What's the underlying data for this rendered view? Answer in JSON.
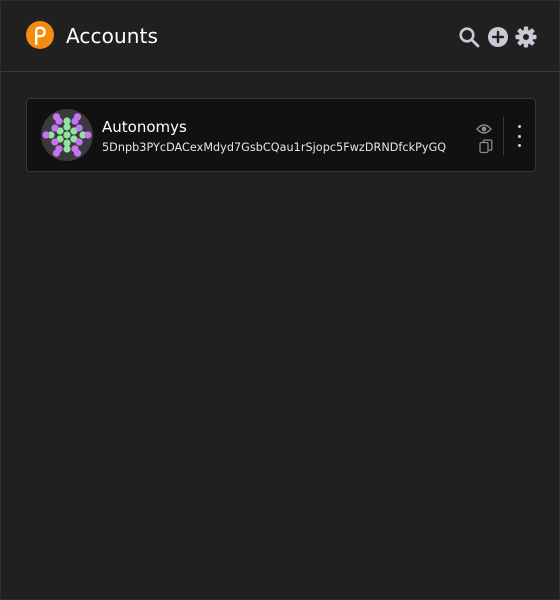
{
  "header": {
    "title": "Accounts",
    "logo_icon": "polkadot-logo-icon",
    "actions": [
      {
        "name": "search",
        "icon": "search-icon"
      },
      {
        "name": "add-account",
        "icon": "plus-circle-icon"
      },
      {
        "name": "settings",
        "icon": "gear-icon"
      }
    ]
  },
  "accounts": [
    {
      "name": "Autonomys",
      "address": "5Dnpb3PYcDACexMdyd7GsbCQau1rSjopc5FwzDRNDfckPyGQ",
      "actions": [
        "eye-icon",
        "copy-icon",
        "more-vertical-icon"
      ]
    }
  ],
  "colors": {
    "background": "#202020",
    "card": "#111111",
    "brand": "#E6007A",
    "logo_orange": "#F58C12",
    "identicon_purple": "#C774F0",
    "identicon_green": "#8FE6A0",
    "icon_gray": "#C8CBD4"
  }
}
